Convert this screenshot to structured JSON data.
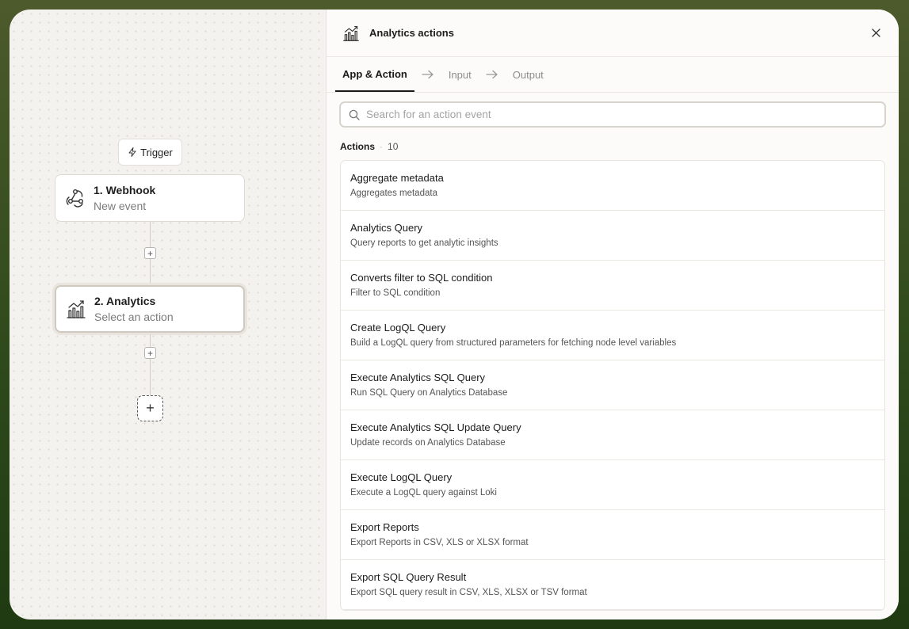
{
  "canvas": {
    "trigger_label": "Trigger",
    "nodes": [
      {
        "title": "1. Webhook",
        "subtitle": "New event"
      },
      {
        "title": "2. Analytics",
        "subtitle": "Select an action"
      }
    ]
  },
  "panel": {
    "title": "Analytics actions",
    "tabs": [
      {
        "label": "App & Action"
      },
      {
        "label": "Input"
      },
      {
        "label": "Output"
      }
    ],
    "search": {
      "placeholder": "Search for an action event",
      "value": ""
    },
    "actions_label": "Actions",
    "actions_count": "10",
    "actions": [
      {
        "title": "Aggregate metadata",
        "description": "Aggregates metadata"
      },
      {
        "title": "Analytics Query",
        "description": "Query reports to get analytic insights"
      },
      {
        "title": "Converts filter to SQL condition",
        "description": "Filter to SQL condition"
      },
      {
        "title": "Create LogQL Query",
        "description": "Build a LogQL query from structured parameters for fetching node level variables"
      },
      {
        "title": "Execute Analytics SQL Query",
        "description": "Run SQL Query on Analytics Database"
      },
      {
        "title": "Execute Analytics SQL Update Query",
        "description": "Update records on Analytics Database"
      },
      {
        "title": "Execute LogQL Query",
        "description": "Execute a LogQL query against Loki"
      },
      {
        "title": "Export Reports",
        "description": "Export Reports in CSV, XLS or XLSX format"
      },
      {
        "title": "Export SQL Query Result",
        "description": "Export SQL query result in CSV, XLS, XLSX or TSV format"
      }
    ]
  },
  "icons": {
    "trigger": "lightning-icon",
    "webhook": "webhook-icon",
    "analytics": "analytics-chart-icon",
    "close": "close-icon",
    "search": "search-icon",
    "tab_separator": "arrow-right-icon"
  },
  "colors": {
    "outer_background": "#3b4f22",
    "canvas_background": "#f4f2ee",
    "panel_background": "#fcfbf9",
    "active_tab": "#1a1a1a"
  }
}
